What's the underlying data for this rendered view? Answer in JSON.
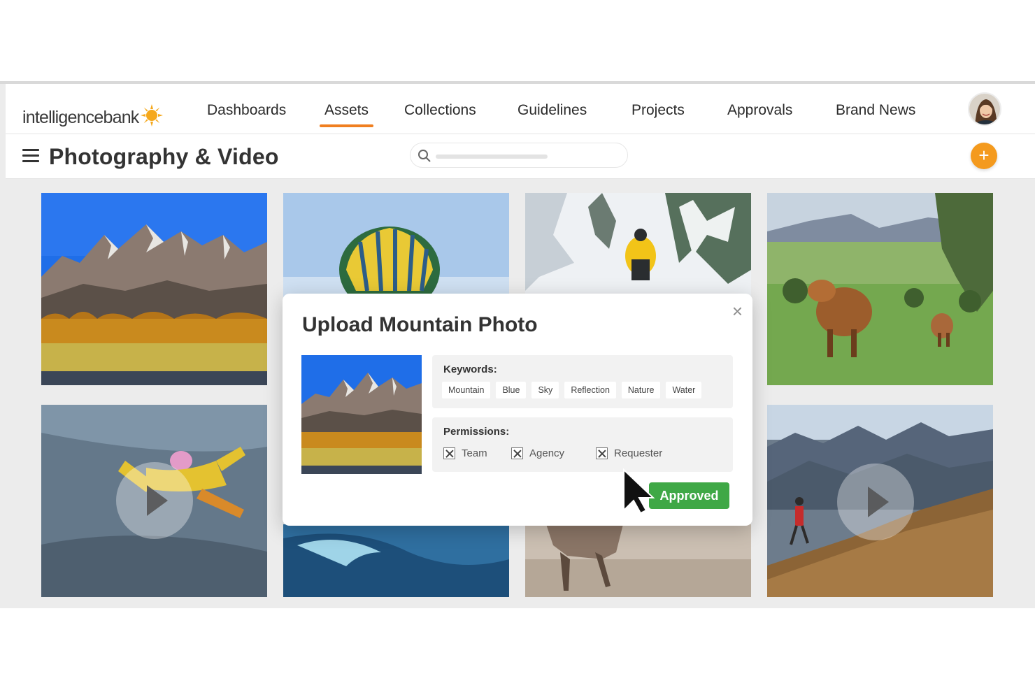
{
  "app": {
    "logo_text": "intelligencebank",
    "logo_icon": "sun-logo-icon",
    "nav": [
      {
        "label": "Dashboards",
        "active": false
      },
      {
        "label": "Assets",
        "active": true
      },
      {
        "label": "Collections",
        "active": false
      },
      {
        "label": "Guidelines",
        "active": false
      },
      {
        "label": "Projects",
        "active": false
      },
      {
        "label": "Approvals",
        "active": false
      },
      {
        "label": "Brand News",
        "active": false
      }
    ],
    "accent_color": "#f07f20"
  },
  "subbar": {
    "title": "Photography & Video",
    "menu_icon": "hamburger-menu-icon",
    "search_icon": "search-icon",
    "add_icon": "plus-icon",
    "add_label": "+"
  },
  "gallery": {
    "tiles": [
      {
        "subject": "mountain range with autumn meadow",
        "video": false
      },
      {
        "subject": "hot air balloon",
        "video": false
      },
      {
        "subject": "hiker in snowy forest",
        "video": false
      },
      {
        "subject": "highland cattle in pasture",
        "video": false
      },
      {
        "subject": "skydiver in free fall",
        "video": true
      },
      {
        "subject": "ocean wave",
        "video": true
      },
      {
        "subject": "horse running on beach",
        "video": true
      },
      {
        "subject": "runner on mountain slope",
        "video": true
      }
    ]
  },
  "modal": {
    "title": "Upload Mountain Photo",
    "close_label": "×",
    "keywords_label": "Keywords:",
    "keywords": [
      "Mountain",
      "Blue",
      "Sky",
      "Reflection",
      "Nature",
      "Water"
    ],
    "permissions_label": "Permissions:",
    "permissions": [
      {
        "label": "Team",
        "checked": true
      },
      {
        "label": "Agency",
        "checked": true
      },
      {
        "label": "Requester",
        "checked": true
      }
    ],
    "approve_label": "Approved",
    "approve_color": "#3fa846"
  }
}
